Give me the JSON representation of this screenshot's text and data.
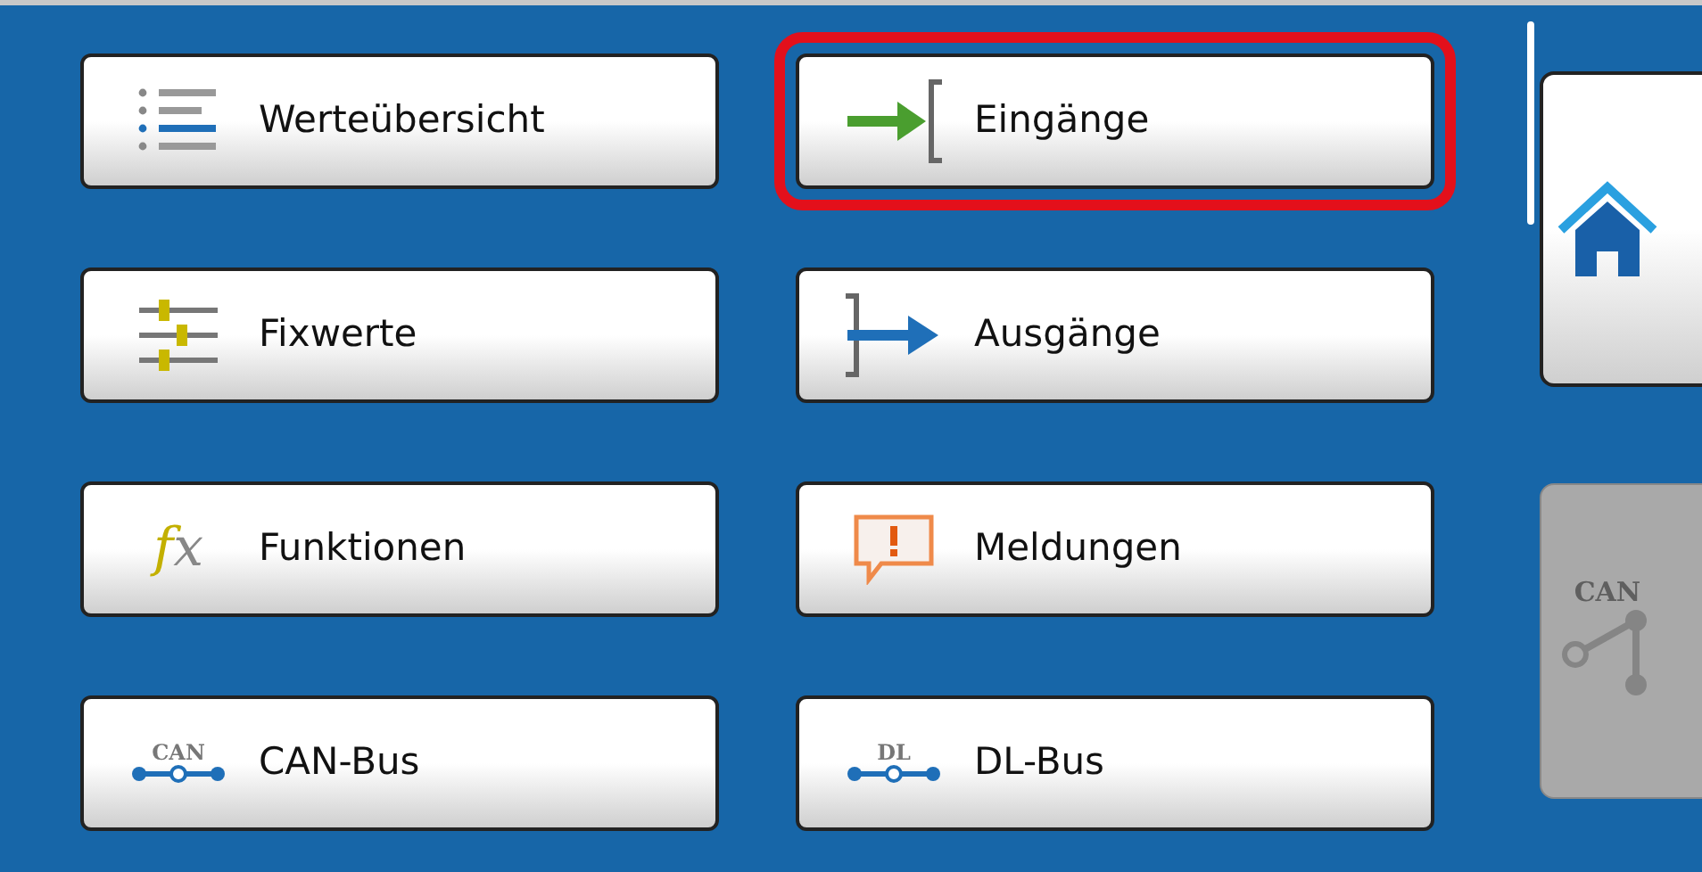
{
  "menu": [
    {
      "label": "Werteübersicht",
      "kind": "list",
      "selected": false
    },
    {
      "label": "Eingänge",
      "kind": "input",
      "selected": true
    },
    {
      "label": "Fixwerte",
      "kind": "sliders",
      "selected": false
    },
    {
      "label": "Ausgänge",
      "kind": "output",
      "selected": false
    },
    {
      "label": "Funktionen",
      "kind": "function",
      "icon_text": "fx",
      "selected": false
    },
    {
      "label": "Meldungen",
      "kind": "message",
      "selected": false
    },
    {
      "label": "CAN-Bus",
      "kind": "bus",
      "icon_text": "CAN",
      "selected": false
    },
    {
      "label": "DL-Bus",
      "kind": "bus",
      "icon_text": "DL",
      "selected": false
    }
  ],
  "side": [
    {
      "kind": "home",
      "disabled": false
    },
    {
      "kind": "network",
      "icon_text": "CAN",
      "disabled": true
    }
  ]
}
